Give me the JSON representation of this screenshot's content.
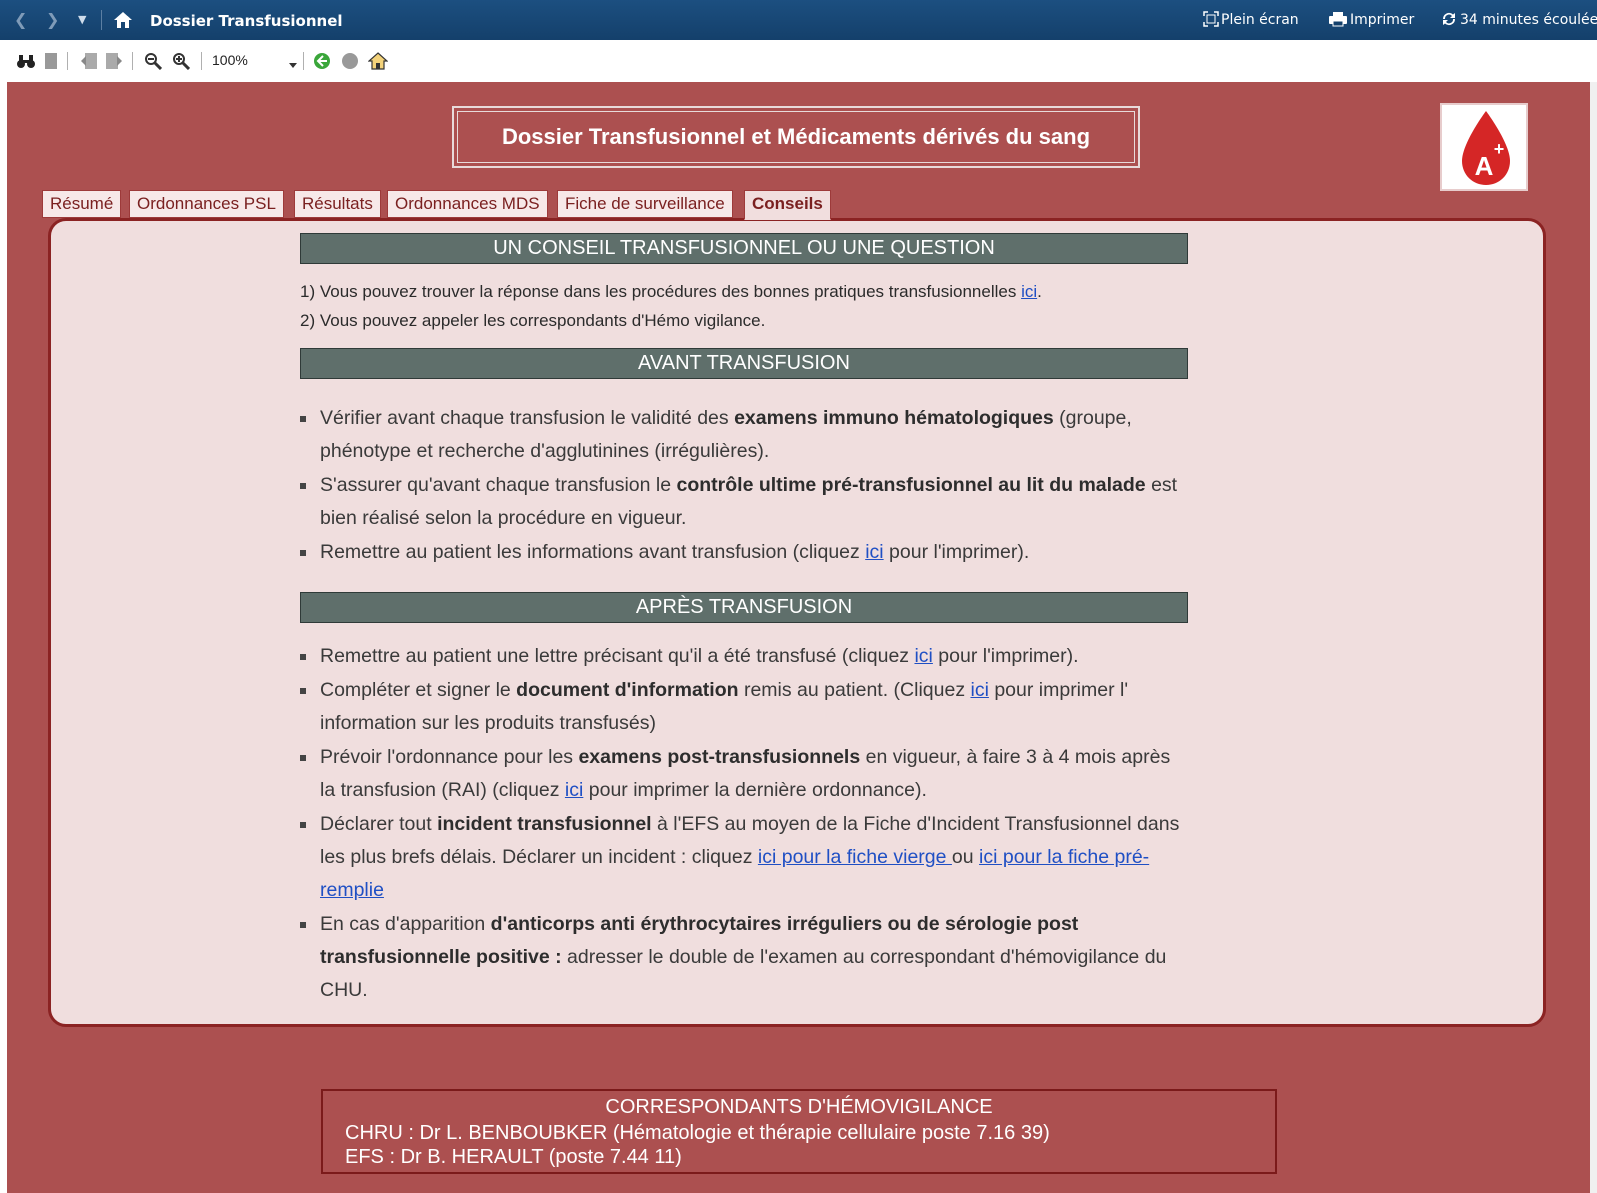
{
  "window": {
    "title": "Dossier Transfusionnel",
    "fullscreen_label": "Plein écran",
    "print_label": "Imprimer",
    "elapsed_label": "34 minutes écoulée"
  },
  "toolbar": {
    "zoom_value": "100%"
  },
  "page": {
    "main_title": "Dossier Transfusionnel et Médicaments dérivés du sang",
    "logo_text": "A"
  },
  "tabs": [
    {
      "label": "Résumé",
      "active": false
    },
    {
      "label": "Ordonnances PSL",
      "active": false
    },
    {
      "label": "Résultats",
      "active": false
    },
    {
      "label": "Ordonnances MDS",
      "active": false
    },
    {
      "label": "Fiche de surveillance",
      "active": false
    },
    {
      "label": "Conseils",
      "active": true
    }
  ],
  "section_question": {
    "header": "UN CONSEIL TRANSFUSIONNEL OU UNE QUESTION",
    "line1": "1) Vous pouvez trouver la réponse dans les procédures des bonnes pratiques transfusionnelles ",
    "line1_link": "ici",
    "line1_end": ".",
    "line2": "2) Vous pouvez appeler les correspondants d'Hémo vigilance."
  },
  "section_avant": {
    "header": "AVANT TRANSFUSION",
    "item1_a": "Vérifier avant chaque transfusion le validité des ",
    "item1_b": "examens immuno hématologiques",
    "item1_c": " (groupe, phénotype et recherche d'agglutinines (irrégulières).",
    "item2_a": "S'assurer qu'avant chaque transfusion le ",
    "item2_b": "contrôle ultime pré-transfusionnel au lit du malade",
    "item2_c": " est bien réalisé selon la procédure en vigueur.",
    "item3_a": "Remettre au patient les informations avant transfusion (cliquez ",
    "item3_link": "ici",
    "item3_c": " pour l'imprimer)."
  },
  "section_apres": {
    "header": "APRÈS TRANSFUSION",
    "item1_a": "Remettre au patient une lettre précisant qu'il a été transfusé (cliquez ",
    "item1_link": "ici",
    "item1_c": " pour l'imprimer).",
    "item2_a": "Compléter et signer le ",
    "item2_b": "document d'information",
    "item2_c": " remis au patient. (Cliquez ",
    "item2_link": "ici",
    "item2_d": " pour imprimer l' information sur les produits transfusés)",
    "item3_a": "Prévoir l'ordonnance pour les ",
    "item3_b": "examens post-transfusionnels",
    "item3_c": " en vigueur, à faire 3 à 4 mois après la transfusion (RAI) (cliquez ",
    "item3_link": "ici",
    "item3_d": " pour imprimer la dernière ordonnance).",
    "item4_a": "Déclarer tout ",
    "item4_b": "incident transfusionnel",
    "item4_c": " à l'EFS au moyen de la Fiche d'Incident Transfusionnel dans les plus brefs délais. Déclarer un incident : cliquez ",
    "item4_link1": "ici pour la fiche vierge ",
    "item4_d": "ou ",
    "item4_link2": "ici pour la fiche pré-remplie",
    "item5_a": "En cas d'apparition ",
    "item5_b": "d'anticorps anti érythrocytaires irréguliers ou de sérologie post transfusionnelle positive :",
    "item5_c": " adresser le double de l'examen au correspondant d'hémovigilance du CHU."
  },
  "correspondants": {
    "title": "CORRESPONDANTS D'HÉMOVIGILANCE",
    "line1": "CHRU : Dr L. BENBOUBKER (Hématologie et thérapie cellulaire poste 7.16 39)",
    "line2": "EFS : Dr B. HERAULT (poste 7.44 11)"
  },
  "colors": {
    "page_bg": "#ac5050",
    "panel_bg": "#f0dede",
    "panel_border": "#8b2323",
    "section_header_bg": "#5f6f6b",
    "link": "#1f4fc4",
    "titlebar_bg": "#14406b"
  }
}
